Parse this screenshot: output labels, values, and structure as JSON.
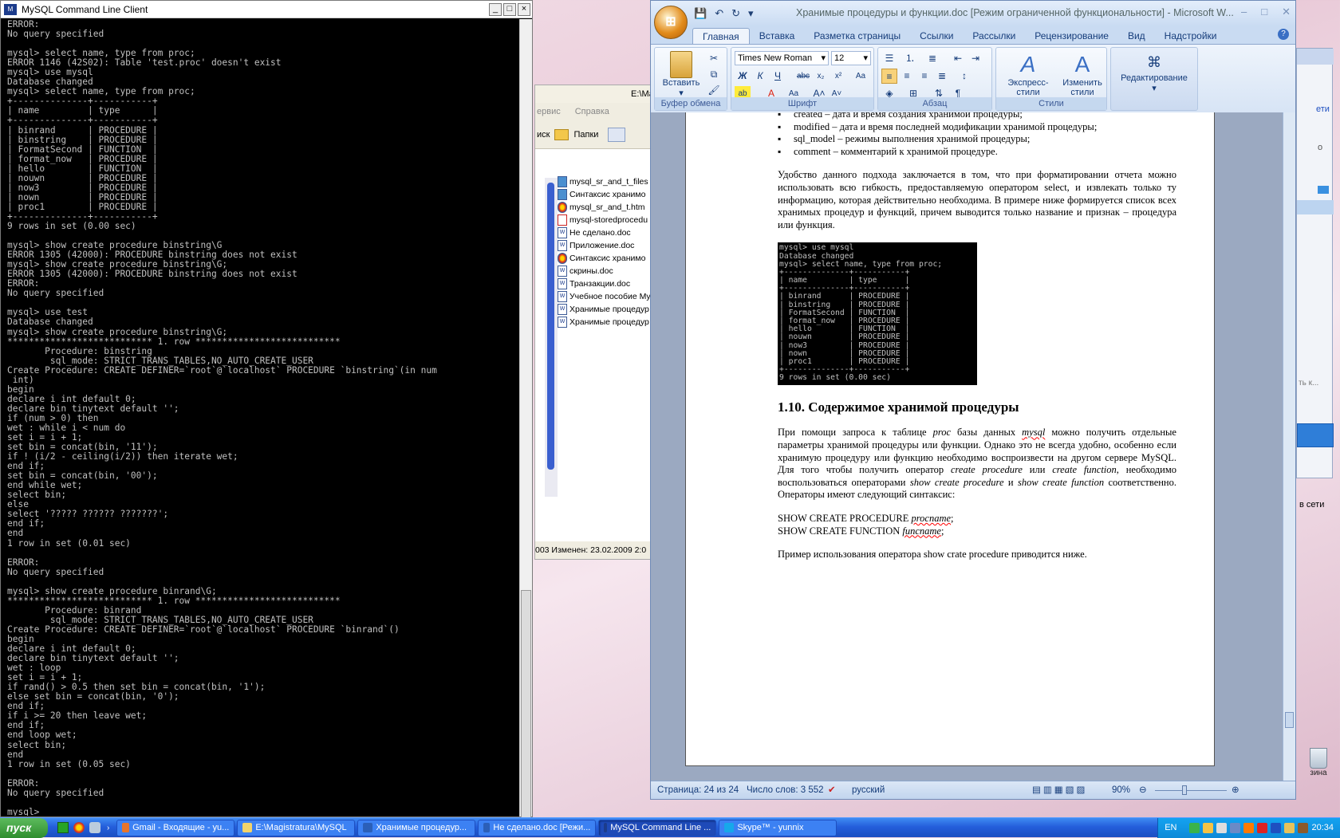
{
  "mysql": {
    "title": "MySQL Command Line Client",
    "icon": "mysql-icon",
    "console_lines": [
      "ERROR:",
      "No query specified",
      "",
      "mysql> select name, type from proc;",
      "ERROR 1146 (42S02): Table 'test.proc' doesn't exist",
      "mysql> use mysql",
      "Database changed",
      "mysql> select name, type from proc;",
      "+--------------+-----------+",
      "| name         | type      |",
      "+--------------+-----------+",
      "| binrand      | PROCEDURE |",
      "| binstring    | PROCEDURE |",
      "| FormatSecond | FUNCTION  |",
      "| format_now   | PROCEDURE |",
      "| hello        | FUNCTION  |",
      "| nouwn        | PROCEDURE |",
      "| now3         | PROCEDURE |",
      "| nown         | PROCEDURE |",
      "| proc1        | PROCEDURE |",
      "+--------------+-----------+",
      "9 rows in set (0.00 sec)",
      "",
      "mysql> show create procedure binstring\\G",
      "ERROR 1305 (42000): PROCEDURE binstring does not exist",
      "mysql> show create procedure binstring\\G;",
      "ERROR 1305 (42000): PROCEDURE binstring does not exist",
      "ERROR:",
      "No query specified",
      "",
      "mysql> use test",
      "Database changed",
      "mysql> show create procedure binstring\\G;",
      "*************************** 1. row ***************************",
      "       Procedure: binstring",
      "        sql_mode: STRICT_TRANS_TABLES,NO_AUTO_CREATE_USER",
      "Create Procedure: CREATE DEFINER=`root`@`localhost` PROCEDURE `binstring`(in num",
      " int)",
      "begin",
      "declare i int default 0;",
      "declare bin tinytext default '';",
      "if (num > 0) then",
      "wet : while i < num do",
      "set i = i + 1;",
      "set bin = concat(bin, '11');",
      "if ! (i/2 - ceiling(i/2)) then iterate wet;",
      "end if;",
      "set bin = concat(bin, '00');",
      "end while wet;",
      "select bin;",
      "else",
      "select '????? ?????? ???????';",
      "end if;",
      "end",
      "1 row in set (0.01 sec)",
      "",
      "ERROR:",
      "No query specified",
      "",
      "mysql> show create procedure binrand\\G;",
      "*************************** 1. row ***************************",
      "       Procedure: binrand",
      "        sql_mode: STRICT_TRANS_TABLES,NO_AUTO_CREATE_USER",
      "Create Procedure: CREATE DEFINER=`root`@`localhost` PROCEDURE `binrand`()",
      "begin",
      "declare i int default 0;",
      "declare bin tinytext default '';",
      "wet : loop",
      "set i = i + 1;",
      "if rand() > 0.5 then set bin = concat(bin, '1');",
      "else set bin = concat(bin, '0');",
      "end if;",
      "if i >= 20 then leave wet;",
      "end if;",
      "end loop wet;",
      "select bin;",
      "end",
      "1 row in set (0.05 sec)",
      "",
      "ERROR:",
      "No query specified",
      "",
      "mysql> _"
    ]
  },
  "explorer": {
    "title": "E:\\Magist",
    "menu": [
      "ервис",
      "Справка"
    ],
    "toolbar": {
      "search": "иск",
      "folders": "Папки"
    },
    "files": [
      {
        "name": "mysql_sr_and_t_files",
        "icon": "folder-icon"
      },
      {
        "name": "Синтаксис хранимо",
        "icon": "folder-icon"
      },
      {
        "name": "mysql_sr_and_t.htm",
        "icon": "chrome-html-icon"
      },
      {
        "name": "mysql-storedprocedu",
        "icon": "pdf-icon"
      },
      {
        "name": "Не сделано.doc",
        "icon": "word-doc-icon"
      },
      {
        "name": "Приложение.doc",
        "icon": "word-doc-icon"
      },
      {
        "name": "Синтаксис хранимо",
        "icon": "chrome-html-icon"
      },
      {
        "name": "скрины.doc",
        "icon": "word-doc-icon"
      },
      {
        "name": "Транзакции.doc",
        "icon": "word-doc-icon"
      },
      {
        "name": "Учебное пособие My",
        "icon": "word-doc-icon"
      },
      {
        "name": "Хранимые процедур",
        "icon": "word-doc-icon"
      },
      {
        "name": "Хранимые процедур",
        "icon": "word-doc-icon"
      }
    ],
    "status": "003 Изменен: 23.02.2009 2:0"
  },
  "word": {
    "title": "Хранимые процедуры и функции.doc [Режим ограниченной функциональности] - Microsoft W...",
    "office_button": "office-button-icon",
    "tabs": [
      "Главная",
      "Вставка",
      "Разметка страницы",
      "Ссылки",
      "Рассылки",
      "Рецензирование",
      "Вид",
      "Надстройки"
    ],
    "active_tab": "Главная",
    "ribbon": {
      "clipboard": {
        "label": "Буфер обмена",
        "paste": "Вставить"
      },
      "font": {
        "label": "Шрифт",
        "font_name": "Times New Roman",
        "font_size": "12"
      },
      "paragraph": {
        "label": "Абзац"
      },
      "styles": {
        "label": "Стили",
        "express": "Экспресс-стили",
        "change": "Изменить стили"
      },
      "editing": {
        "label": "Редактирование"
      }
    },
    "document": {
      "bullets": [
        "created – дата и время создания хранимой процедуры;",
        "modified – дата и время последней модификации хранимой процедуры;",
        "sql_model – режимы выполнения хранимой процедуры;",
        "comment – комментарий к хранимой процедуре."
      ],
      "para1": "Удобство данного подхода заключается в том, что при форматировании отчета можно использовать всю гибкость, предоставляемую оператором select, и извлекать только ту информацию, которая действительно необходима. В примере ниже формируется список всех хранимых процедур и функций, причем выводится только название и признак – процедура или функция.",
      "screenshot_lines": [
        "mysql> use mysql",
        "Database changed",
        "mysql> select name, type from proc;",
        "+--------------+-----------+",
        "| name         | type      |",
        "+--------------+-----------+",
        "| binrand      | PROCEDURE |",
        "| binstring    | PROCEDURE |",
        "| FormatSecond | FUNCTION  |",
        "| format_now   | PROCEDURE |",
        "| hello        | FUNCTION  |",
        "| nouwn        | PROCEDURE |",
        "| now3         | PROCEDURE |",
        "| nown         | PROCEDURE |",
        "| proc1        | PROCEDURE |",
        "+--------------+-----------+",
        "9 rows in set (0.00 sec)"
      ],
      "heading": "1.10. Содержимое хранимой процедуры",
      "para2_a": "При помощи запроса к таблице ",
      "para2_proc": "proc",
      "para2_b": " базы данных ",
      "para2_mysql": "mysql",
      "para2_c": " можно получить отдельные параметры хранимой процедуры или функции. Однако это не всегда удобно, особенно если хранимую процедуру или функцию необходимо воспроизвести на другом сервере MySQL. Для того чтобы получить оператор ",
      "para2_cp": "create procedure",
      "para2_d": " или ",
      "para2_cf": "create function",
      "para2_e": ", необходимо воспользоваться операторами ",
      "para2_scp": "show create procedure",
      "para2_f": " и ",
      "para2_scf": "show create function",
      "para2_g": " соответственно. Операторы имеют следующий синтаксис:",
      "syntax1_a": "SHOW CREATE PROCEDURE ",
      "syntax1_b": "procname",
      "syntax1_c": ";",
      "syntax2_a": "SHOW CREATE FUNCTION ",
      "syntax2_b": "funcname",
      "syntax2_c": ";",
      "para3": "Пример использования оператора show crate procedure приводится ниже."
    },
    "status": {
      "page": "Страница: 24 из 24",
      "words": "Число слов: 3 552",
      "language": "русский",
      "zoom": "90%"
    }
  },
  "bgwin": {
    "texts": [
      "ети",
      "о",
      "ть к...",
      "в сети"
    ]
  },
  "desktop": {
    "recycle_label": "зина"
  },
  "taskbar": {
    "start": "пуск",
    "buttons": [
      {
        "label": "Gmail - Входящие - yu...",
        "icon_color": "#e8742a",
        "active": false
      },
      {
        "label": "E:\\Magistratura\\MySQL",
        "icon_color": "#f3d36a",
        "active": false
      },
      {
        "label": "Хранимые процедур...",
        "icon_color": "#2b5fb8",
        "active": false
      },
      {
        "label": "Не сделано.doc [Режи...",
        "icon_color": "#2b5fb8",
        "active": false
      },
      {
        "label": "MySQL Command Line ...",
        "icon_color": "#1c3c8c",
        "active": true
      },
      {
        "label": "Skype™ - yunnix",
        "icon_color": "#17a8ea",
        "active": false
      }
    ],
    "lang": "EN",
    "time": "20:34"
  }
}
